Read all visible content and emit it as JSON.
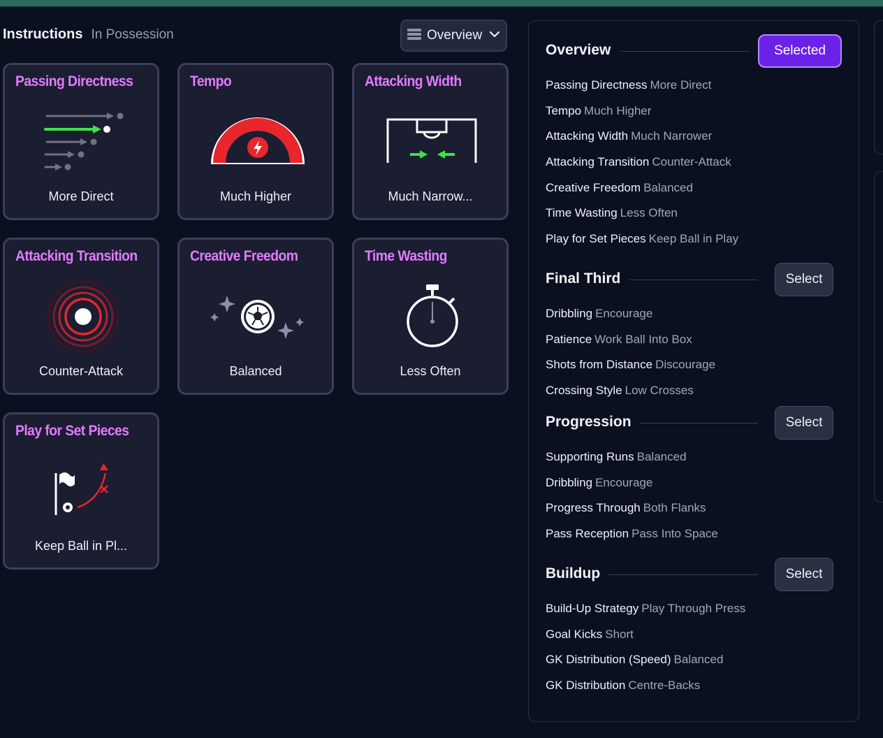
{
  "header": {
    "title": "Instructions",
    "subtitle": "In Possession"
  },
  "view_select": {
    "label": "Overview",
    "icon": "list-icon",
    "chevron": "chevron-down-icon"
  },
  "cards": [
    {
      "title": "Passing Directness",
      "value": "More Direct",
      "icon": "passing-arrows-icon"
    },
    {
      "title": "Tempo",
      "value": "Much Higher",
      "icon": "tempo-gauge-icon"
    },
    {
      "title": "Attacking Width",
      "value": "Much Narrow...",
      "icon": "pitch-width-icon"
    },
    {
      "title": "Attacking Transition",
      "value": "Counter-Attack",
      "icon": "target-rings-icon"
    },
    {
      "title": "Creative Freedom",
      "value": "Balanced",
      "icon": "sparkle-ball-icon"
    },
    {
      "title": "Time Wasting",
      "value": "Less Often",
      "icon": "stopwatch-icon"
    },
    {
      "title": "Play for Set Pieces",
      "value": "Keep Ball in Pl...",
      "icon": "corner-flag-icon"
    }
  ],
  "overview": {
    "title": "Overview",
    "button": "Selected",
    "items": [
      {
        "k": "Passing Directness",
        "v": "More Direct"
      },
      {
        "k": "Tempo",
        "v": "Much Higher"
      },
      {
        "k": "Attacking Width",
        "v": "Much Narrower"
      },
      {
        "k": "Attacking Transition",
        "v": "Counter-Attack"
      },
      {
        "k": "Creative Freedom",
        "v": "Balanced"
      },
      {
        "k": "Time Wasting",
        "v": "Less Often"
      },
      {
        "k": "Play for Set Pieces",
        "v": "Keep Ball in Play"
      }
    ]
  },
  "final_third": {
    "title": "Final Third",
    "button": "Select",
    "items": [
      {
        "k": "Dribbling",
        "v": "Encourage"
      },
      {
        "k": "Patience",
        "v": "Work Ball Into Box"
      },
      {
        "k": "Shots from Distance",
        "v": "Discourage"
      },
      {
        "k": "Crossing Style",
        "v": "Low Crosses"
      }
    ]
  },
  "progression": {
    "title": "Progression",
    "button": "Select",
    "items": [
      {
        "k": "Supporting Runs",
        "v": "Balanced"
      },
      {
        "k": "Dribbling",
        "v": "Encourage"
      },
      {
        "k": "Progress Through",
        "v": "Both Flanks"
      },
      {
        "k": "Pass Reception",
        "v": "Pass Into Space"
      }
    ]
  },
  "buildup": {
    "title": "Buildup",
    "button": "Select",
    "items": [
      {
        "k": "Build-Up Strategy",
        "v": "Play Through Press"
      },
      {
        "k": "Goal Kicks",
        "v": "Short"
      },
      {
        "k": "GK Distribution (Speed)",
        "v": "Balanced"
      },
      {
        "k": "GK Distribution",
        "v": "Centre-Backs"
      }
    ]
  },
  "colors": {
    "accent": "#6a22e8",
    "card_title": "#e27bff",
    "green": "#3fe04a",
    "red": "#e8262c"
  }
}
